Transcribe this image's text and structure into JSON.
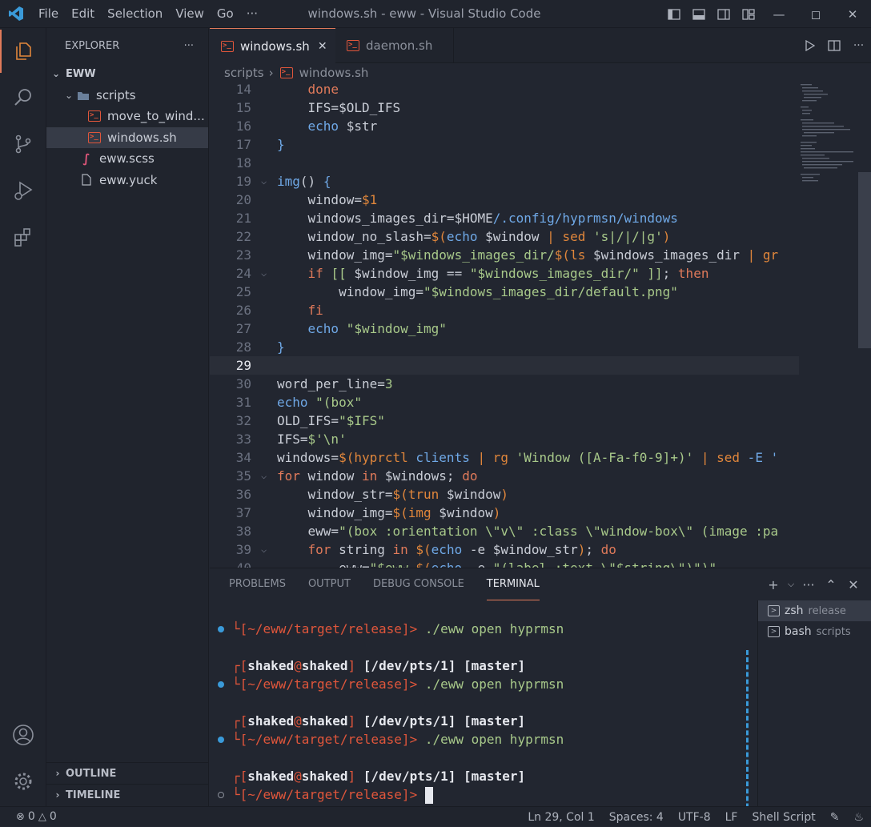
{
  "window": {
    "title": "windows.sh - eww - Visual Studio Code",
    "menu": [
      "File",
      "Edit",
      "Selection",
      "View",
      "Go",
      "···"
    ]
  },
  "activity_bar": [
    "explorer-icon",
    "search-icon",
    "source-control-icon",
    "run-debug-icon",
    "extensions-icon",
    "account-icon",
    "settings-gear-icon"
  ],
  "sidebar": {
    "header": "EXPLORER",
    "more": "···",
    "root": "EWW",
    "folder": "scripts",
    "items": [
      {
        "label": "move_to_wind...",
        "icon": "shell-file-icon"
      },
      {
        "label": "windows.sh",
        "icon": "shell-file-icon"
      },
      {
        "label": "eww.scss",
        "icon": "sass-file-icon"
      },
      {
        "label": "eww.yuck",
        "icon": "file-icon"
      }
    ],
    "outline": "OUTLINE",
    "timeline": "TIMELINE"
  },
  "tabs": [
    {
      "label": "windows.sh",
      "active": true
    },
    {
      "label": "daemon.sh",
      "active": false
    }
  ],
  "breadcrumb": {
    "folder": "scripts",
    "file": "windows.sh"
  },
  "editor": {
    "current_line": 29,
    "lines": [
      {
        "n": "14",
        "fold": "",
        "tokens": [
          [
            "    ",
            "v"
          ],
          [
            "done",
            "k"
          ]
        ]
      },
      {
        "n": "15",
        "fold": "",
        "tokens": [
          [
            "    IFS=$OLD_IFS",
            "v"
          ]
        ]
      },
      {
        "n": "16",
        "fold": "",
        "tokens": [
          [
            "    ",
            "v"
          ],
          [
            "echo",
            "b"
          ],
          [
            " $str",
            "v"
          ]
        ]
      },
      {
        "n": "17",
        "fold": "",
        "tokens": [
          [
            "}",
            "b"
          ]
        ]
      },
      {
        "n": "18",
        "fold": "",
        "tokens": []
      },
      {
        "n": "19",
        "fold": "⌵",
        "tokens": [
          [
            "img",
            "b"
          ],
          [
            "() ",
            "v"
          ],
          [
            "{",
            "b"
          ]
        ]
      },
      {
        "n": "20",
        "fold": "",
        "tokens": [
          [
            "    window=",
            "v"
          ],
          [
            "$1",
            "f"
          ]
        ]
      },
      {
        "n": "21",
        "fold": "",
        "tokens": [
          [
            "    windows_images_dir=",
            "v"
          ],
          [
            "$HOME",
            "v"
          ],
          [
            "/.config/hyprmsn/windows",
            "b"
          ]
        ]
      },
      {
        "n": "22",
        "fold": "",
        "tokens": [
          [
            "    window_no_slash=",
            "v"
          ],
          [
            "$(",
            "f"
          ],
          [
            "echo",
            "b"
          ],
          [
            " $window ",
            "v"
          ],
          [
            "|",
            "f"
          ],
          [
            " ",
            "v"
          ],
          [
            "sed",
            "f"
          ],
          [
            " ",
            "v"
          ],
          [
            "'s|/|",
            "s"
          ],
          [
            "/",
            "s"
          ],
          [
            "|g'",
            "s"
          ],
          [
            ")",
            "f"
          ]
        ]
      },
      {
        "n": "23",
        "fold": "",
        "tokens": [
          [
            "    window_img=",
            "v"
          ],
          [
            "\"$windows_images_dir/",
            "s"
          ],
          [
            "$(",
            "f"
          ],
          [
            "ls",
            "f"
          ],
          [
            " $windows_images_dir ",
            "v"
          ],
          [
            "| gr",
            "f"
          ]
        ]
      },
      {
        "n": "24",
        "fold": "⌵",
        "tokens": [
          [
            "    ",
            "v"
          ],
          [
            "if",
            "k"
          ],
          [
            " ",
            "v"
          ],
          [
            "[[",
            "s"
          ],
          [
            " $window_img == ",
            "v"
          ],
          [
            "\"$windows_images_dir/\"",
            "s"
          ],
          [
            " ",
            "v"
          ],
          [
            "]]",
            "s"
          ],
          [
            "; ",
            "v"
          ],
          [
            "then",
            "k"
          ]
        ]
      },
      {
        "n": "25",
        "fold": "",
        "tokens": [
          [
            "        window_img=",
            "v"
          ],
          [
            "\"$windows_images_dir/default.png\"",
            "s"
          ]
        ]
      },
      {
        "n": "26",
        "fold": "",
        "tokens": [
          [
            "    ",
            "v"
          ],
          [
            "fi",
            "k"
          ]
        ]
      },
      {
        "n": "27",
        "fold": "",
        "tokens": [
          [
            "    ",
            "v"
          ],
          [
            "echo",
            "b"
          ],
          [
            " ",
            "v"
          ],
          [
            "\"$window_img\"",
            "s"
          ]
        ]
      },
      {
        "n": "28",
        "fold": "",
        "tokens": [
          [
            "}",
            "b"
          ]
        ]
      },
      {
        "n": "29",
        "fold": "",
        "tokens": []
      },
      {
        "n": "30",
        "fold": "",
        "tokens": [
          [
            "word_per_line=",
            "v"
          ],
          [
            "3",
            "s"
          ]
        ]
      },
      {
        "n": "31",
        "fold": "",
        "tokens": [
          [
            "echo",
            "b"
          ],
          [
            " ",
            "v"
          ],
          [
            "\"(box\"",
            "s"
          ]
        ]
      },
      {
        "n": "32",
        "fold": "",
        "tokens": [
          [
            "OLD_IFS=",
            "v"
          ],
          [
            "\"$IFS\"",
            "s"
          ]
        ]
      },
      {
        "n": "33",
        "fold": "",
        "tokens": [
          [
            "IFS=",
            "v"
          ],
          [
            "$'\\n'",
            "s"
          ]
        ]
      },
      {
        "n": "34",
        "fold": "",
        "tokens": [
          [
            "windows=",
            "v"
          ],
          [
            "$(",
            "f"
          ],
          [
            "hyprctl",
            "f"
          ],
          [
            " clients ",
            "b"
          ],
          [
            "|",
            "f"
          ],
          [
            " ",
            "v"
          ],
          [
            "rg",
            "f"
          ],
          [
            " ",
            "v"
          ],
          [
            "'Window ([A-Fa-f0-9]+)'",
            "s"
          ],
          [
            " ",
            "v"
          ],
          [
            "|",
            "f"
          ],
          [
            " ",
            "v"
          ],
          [
            "sed",
            "f"
          ],
          [
            " -E '",
            "b"
          ]
        ]
      },
      {
        "n": "35",
        "fold": "⌵",
        "tokens": [
          [
            "for",
            "k"
          ],
          [
            " window ",
            "v"
          ],
          [
            "in",
            "k"
          ],
          [
            " $windows; ",
            "v"
          ],
          [
            "do",
            "k"
          ]
        ]
      },
      {
        "n": "36",
        "fold": "",
        "tokens": [
          [
            "    window_str=",
            "v"
          ],
          [
            "$(",
            "f"
          ],
          [
            "trun",
            "f"
          ],
          [
            " $window",
            "v"
          ],
          [
            ")",
            "f"
          ]
        ]
      },
      {
        "n": "37",
        "fold": "",
        "tokens": [
          [
            "    window_img=",
            "v"
          ],
          [
            "$(",
            "f"
          ],
          [
            "img",
            "f"
          ],
          [
            " $window",
            "v"
          ],
          [
            ")",
            "f"
          ]
        ]
      },
      {
        "n": "38",
        "fold": "",
        "tokens": [
          [
            "    eww=",
            "v"
          ],
          [
            "\"(box :orientation \\\"v\\\" :class \\\"window-box\\\" (image :pa",
            "s"
          ]
        ]
      },
      {
        "n": "39",
        "fold": "⌵",
        "tokens": [
          [
            "    ",
            "v"
          ],
          [
            "for",
            "k"
          ],
          [
            " string ",
            "v"
          ],
          [
            "in",
            "k"
          ],
          [
            " ",
            "v"
          ],
          [
            "$(",
            "f"
          ],
          [
            "echo",
            "b"
          ],
          [
            " -e $window_str",
            "v"
          ],
          [
            ")",
            "f"
          ],
          [
            "; ",
            "v"
          ],
          [
            "do",
            "k"
          ]
        ]
      },
      {
        "n": "40",
        "fold": "",
        "tokens": [
          [
            "        eww=",
            "v"
          ],
          [
            "\"$eww ",
            "s"
          ],
          [
            "$(",
            "f"
          ],
          [
            "echo",
            "b"
          ],
          [
            " -e ",
            "v"
          ],
          [
            "\"(label :text \\\"$string\\\")\"",
            "s"
          ],
          [
            ")\"",
            "s"
          ]
        ]
      }
    ]
  },
  "panel": {
    "tabs": [
      "PROBLEMS",
      "OUTPUT",
      "DEBUG CONSOLE",
      "TERMINAL"
    ],
    "active_tab": "TERMINAL",
    "actions": [
      "+",
      "⌵",
      "···",
      "⌃",
      "✕"
    ],
    "terminal": {
      "prompt_path": "[~/eww/target/release]>",
      "command": "./eww open hyprmsn",
      "user": "shaked",
      "at": "@",
      "host": "shaked",
      "tty": "[/dev/pts/1]",
      "branch": "[master]"
    },
    "sessions": [
      {
        "name": "zsh",
        "sub": "release"
      },
      {
        "name": "bash",
        "sub": "scripts"
      }
    ]
  },
  "status": {
    "errors": "0",
    "warnings": "0",
    "position": "Ln 29, Col 1",
    "spaces": "Spaces: 4",
    "encoding": "UTF-8",
    "eol": "LF",
    "language": "Shell Script"
  },
  "colors": {
    "accent": "#e07a5a",
    "keyword": "#e07a5a",
    "builtin": "#6fa8e6",
    "string": "#a8c98a",
    "terminal_dot": "#3a9ad9"
  }
}
